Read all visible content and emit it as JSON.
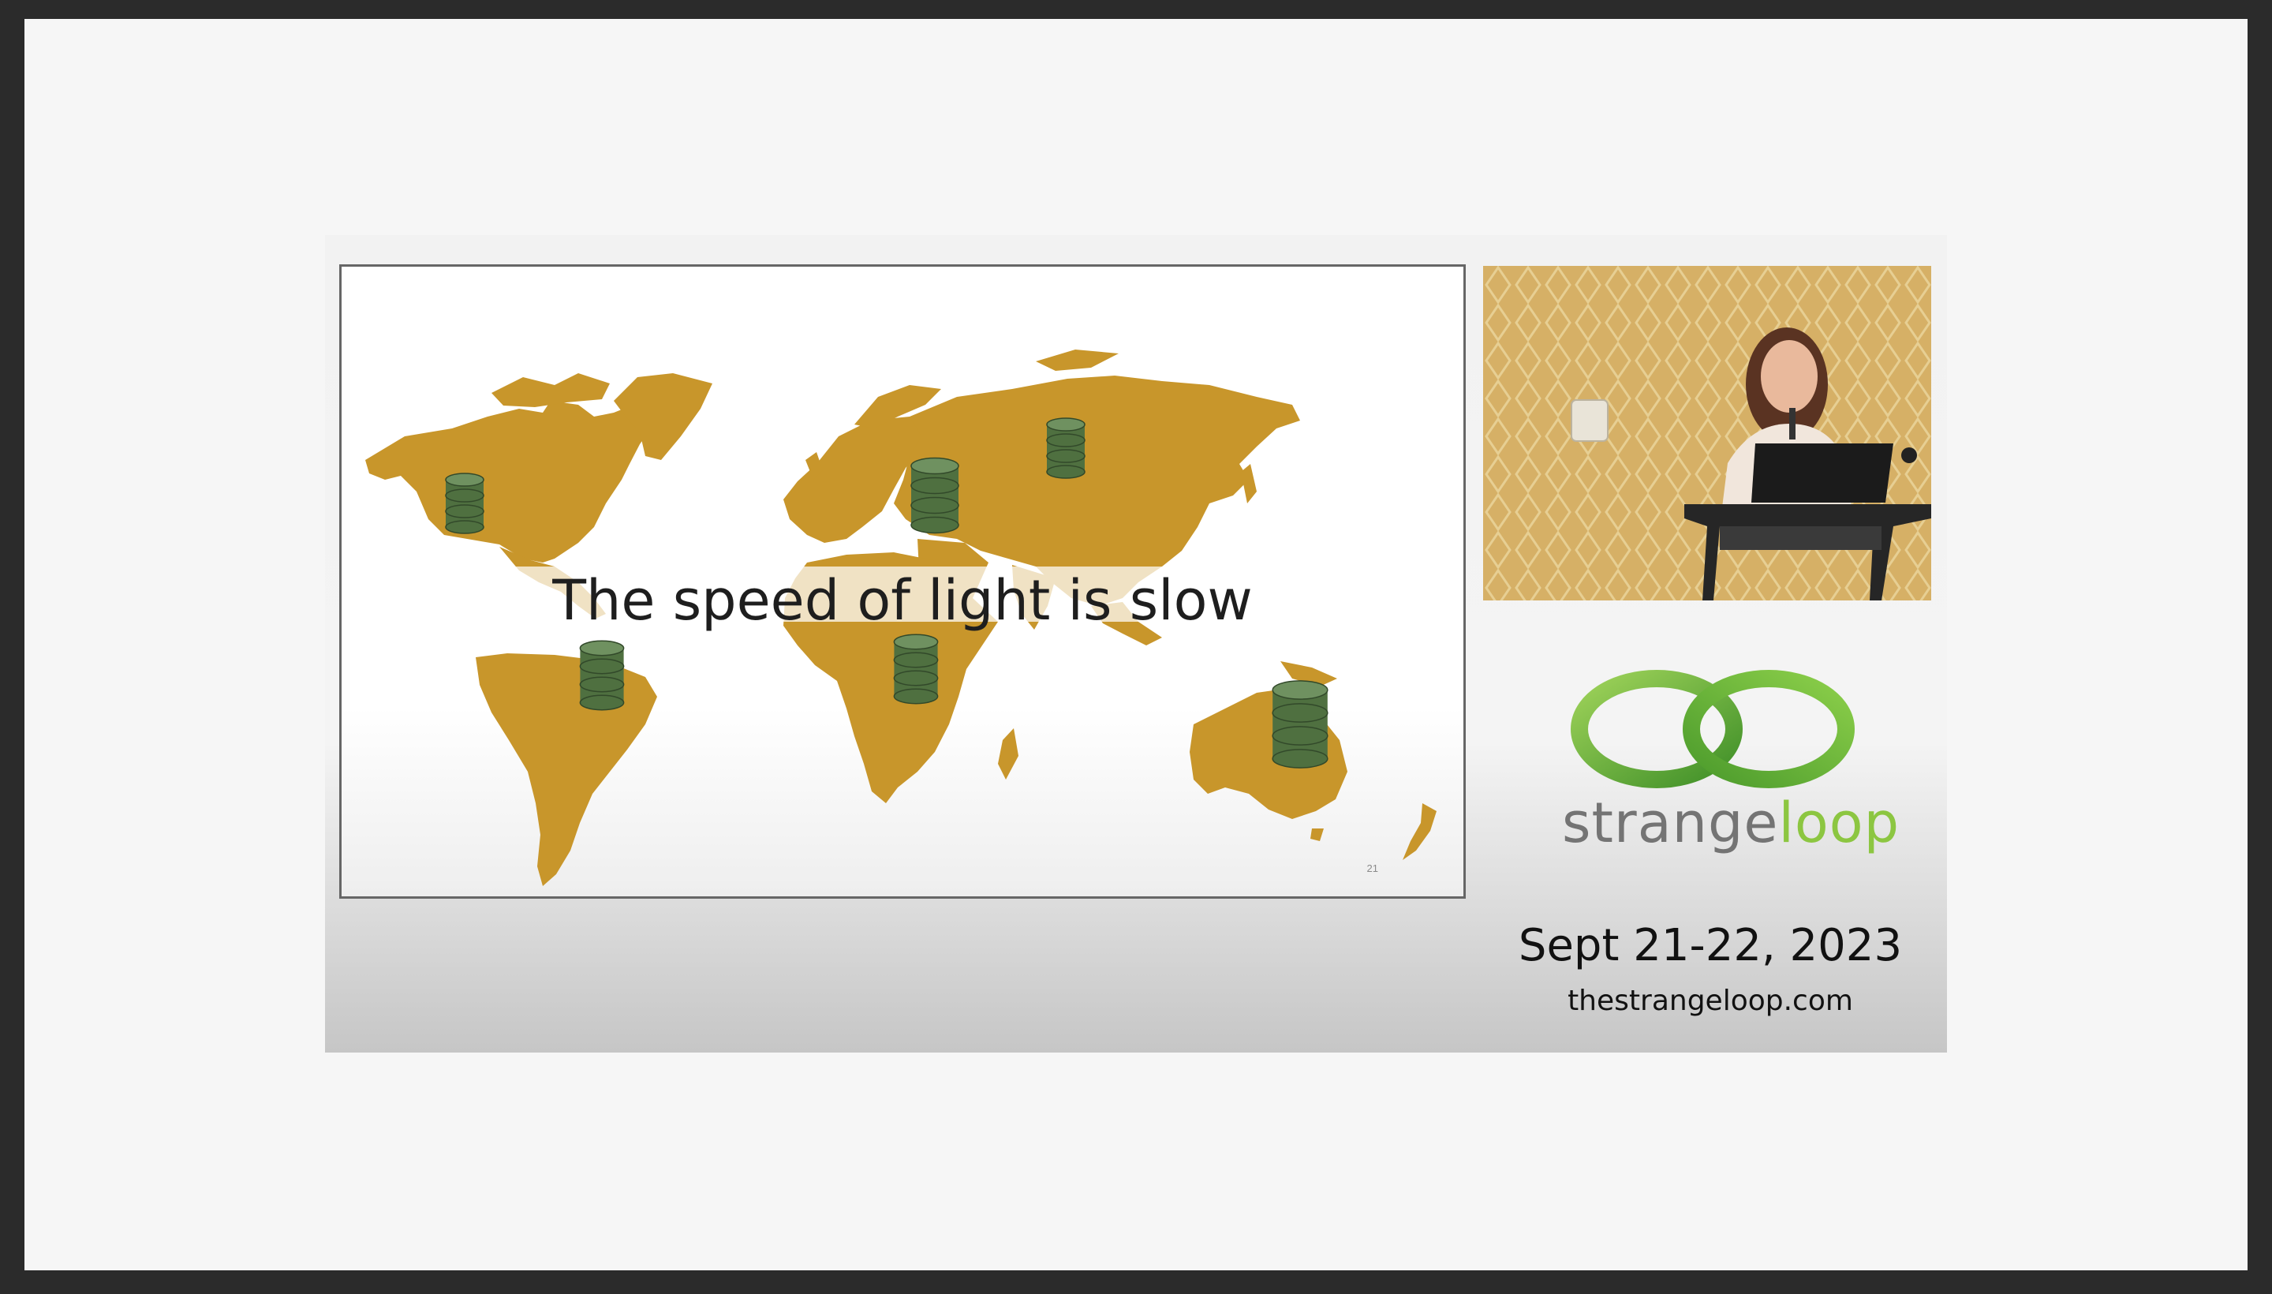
{
  "slide": {
    "title": "The speed of light is slow",
    "page_number": "21"
  },
  "sidebar": {
    "logo_word_left": "strange",
    "logo_word_right": "loop",
    "dates": "Sept 21-22, 2023",
    "url": "thestrangeloop.com"
  },
  "icons": {
    "database": "database-icon",
    "logo": "infinity-logo-icon"
  },
  "colors": {
    "continent": "#c8962b",
    "database": "#4f7040",
    "logo_green": "#6db033"
  }
}
